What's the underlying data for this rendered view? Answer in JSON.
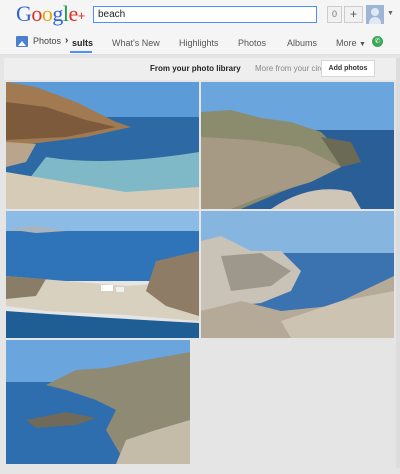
{
  "header": {
    "logo_letters": [
      {
        "ch": "G",
        "color": "#3366cc"
      },
      {
        "ch": "o",
        "color": "#d93025"
      },
      {
        "ch": "o",
        "color": "#e8a800"
      },
      {
        "ch": "g",
        "color": "#3366cc"
      },
      {
        "ch": "l",
        "color": "#1a9a4a"
      },
      {
        "ch": "e",
        "color": "#d93025"
      }
    ],
    "logo_plus": "+",
    "search_value": "beach",
    "notification_count": "0",
    "share_label": "+"
  },
  "nav": {
    "app_label": "Photos",
    "tabs": [
      "sults",
      "What's New",
      "Highlights",
      "Photos",
      "Albums"
    ],
    "more_label": "More"
  },
  "subbar": {
    "library_label": "From your photo library",
    "more_label": "More from your circ",
    "add_photos_label": "Add photos"
  },
  "photos": [
    {
      "name": "beach-photo-1",
      "subject": "sandy cove with rocky cliff"
    },
    {
      "name": "beach-photo-2",
      "subject": "coastal hills and shore"
    },
    {
      "name": "beach-photo-3",
      "subject": "bay with small white building"
    },
    {
      "name": "beach-photo-4",
      "subject": "white rock formation by sea"
    },
    {
      "name": "beach-photo-5",
      "subject": "rocky peninsula coastline"
    }
  ]
}
